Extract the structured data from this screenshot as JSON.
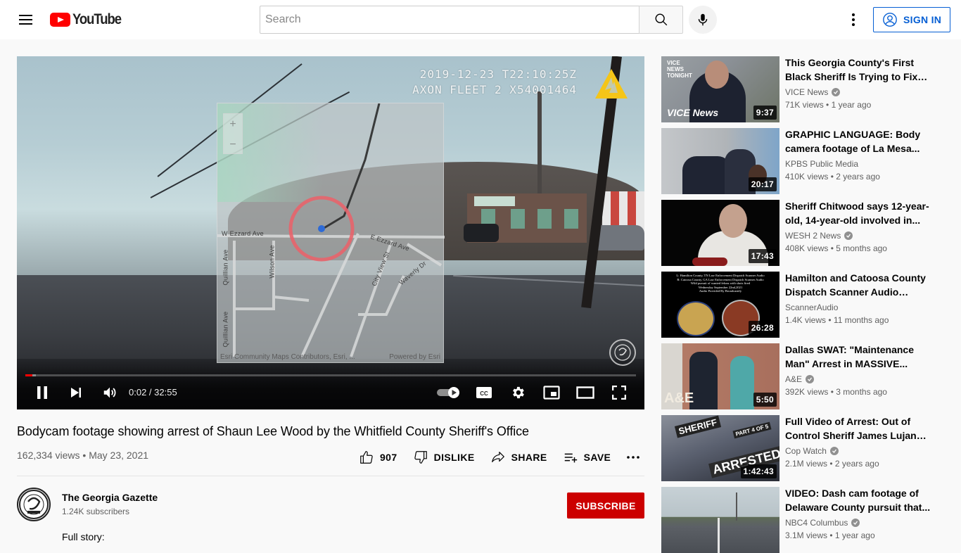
{
  "header": {
    "logo_text": "YouTube",
    "search_placeholder": "Search",
    "search_value": "",
    "signin_label": "SIGN IN",
    "icons": {
      "menu": "hamburger-menu-icon",
      "search": "search-icon",
      "mic": "microphone-icon",
      "more": "vertical-dots-icon",
      "account": "account-circle-icon"
    }
  },
  "player": {
    "overlay_timestamp": "2019-12-23 T22:10:25Z",
    "overlay_device": "AXON FLEET 2 X54001464",
    "map": {
      "zoom_in": "+",
      "zoom_out": "−",
      "streets": [
        "W Ezzard Ave",
        "E Ezzard Ave",
        "Quillian Ave",
        "Quillian Ave",
        "Wilson Ave",
        "City View St",
        "Waverly Dr"
      ],
      "attribution_left": "Esri Community Maps Contributors, Esri, ...",
      "attribution_right": "Powered by Esri"
    },
    "current_time": "0:02",
    "duration": "32:55",
    "time_display": "0:02 / 32:55",
    "progress_fraction": 0.001,
    "buffered_fraction": 0.017,
    "state": "playing",
    "controls": [
      "pause",
      "next",
      "volume",
      "autoplay-toggle",
      "subtitles",
      "settings",
      "miniplayer",
      "theater-mode",
      "fullscreen"
    ],
    "cc_label": "CC"
  },
  "video": {
    "title": "Bodycam footage showing arrest of Shaun Lee Wood by the Whitfield County Sheriff's Office",
    "views": "162,334 views",
    "separator": "•",
    "date": "May 23, 2021",
    "likes": "907",
    "dislike_label": "DISLIKE",
    "share_label": "SHARE",
    "save_label": "SAVE",
    "more_label": "..."
  },
  "channel": {
    "name": "The Georgia Gazette",
    "subscribers": "1.24K subscribers",
    "subscribe_label": "SUBSCRIBE",
    "description_start": "Full story:"
  },
  "recommendations": [
    {
      "title": "This Georgia County's First Black Sheriff Is Trying to Fix th...",
      "channel": "VICE News",
      "verified": true,
      "views": "71K views",
      "age": "1 year ago",
      "duration": "9:37",
      "thumb_colors": [
        "#8a8f93",
        "#1d2230",
        "#5c6b5d"
      ]
    },
    {
      "title": "GRAPHIC LANGUAGE: Body camera footage of La Mesa...",
      "channel": "KPBS Public Media",
      "verified": false,
      "views": "410K views",
      "age": "2 years ago",
      "duration": "20:17",
      "thumb_colors": [
        "#b9bcc0",
        "#1f2433",
        "#6a8fb8"
      ]
    },
    {
      "title": "Sheriff Chitwood says 12-year-old, 14-year-old involved in...",
      "channel": "WESH 2 News",
      "verified": true,
      "views": "408K views",
      "age": "5 months ago",
      "duration": "17:43",
      "thumb_colors": [
        "#050505",
        "#e8e6e2",
        "#c4a18e"
      ]
    },
    {
      "title": "Hamilton and Catoosa County Dispatch Scanner Audio arme...",
      "channel": "ScannerAudio",
      "verified": false,
      "views": "1.4K views",
      "age": "11 months ago",
      "duration": "26:28",
      "thumb_colors": [
        "#000000",
        "#c9a451",
        "#8a3a24"
      ]
    },
    {
      "title": "Dallas SWAT: \"Maintenance Man\" Arrest in MASSIVE...",
      "channel": "A&E",
      "verified": true,
      "views": "392K views",
      "age": "3 months ago",
      "duration": "5:50",
      "thumb_colors": [
        "#b27a66",
        "#1e2430",
        "#4fa8a8"
      ]
    },
    {
      "title": "Full Video of Arrest: Out of Control Sheriff James Lujan b...",
      "channel": "Cop Watch",
      "verified": true,
      "views": "2.1M views",
      "age": "2 years ago",
      "duration": "1:42:43",
      "thumb_colors": [
        "#5b6170",
        "#2a2d36",
        "#d7d2c5"
      ]
    },
    {
      "title": "VIDEO: Dash cam footage of Delaware County pursuit that...",
      "channel": "NBC4 Columbus",
      "verified": true,
      "views": "3.1M views",
      "age": "1 year ago",
      "duration": "",
      "thumb_colors": [
        "#c7d1d6",
        "#5f6c58",
        "#5c6066"
      ]
    }
  ],
  "thumb_overlays": {
    "vice_brand": "VICE NEWS TONIGHT",
    "vice_logo": "VICE News",
    "scanner_lines": [
      "L: Hamilton County, TN Law Enforcement Dispatch Scanner Audio",
      "R: Catoosa County, GA Law Enforcement Dispatch Scanner Audio",
      "Wild pursuit of wanted felons with shots fired",
      "Wednesday September 22nd,2021",
      "Audio Provided By Broadcastify"
    ],
    "ae_logo": "A&E",
    "copwatch_text": [
      "SHERIFF",
      "PART 4 OF 5",
      "ARRESTED"
    ]
  },
  "colors": {
    "brand_red": "#ff0000",
    "subscribe_red": "#cc0000",
    "link_blue": "#065fd4",
    "progress_red": "#ff0000",
    "axon_yellow": "#f5c518"
  }
}
